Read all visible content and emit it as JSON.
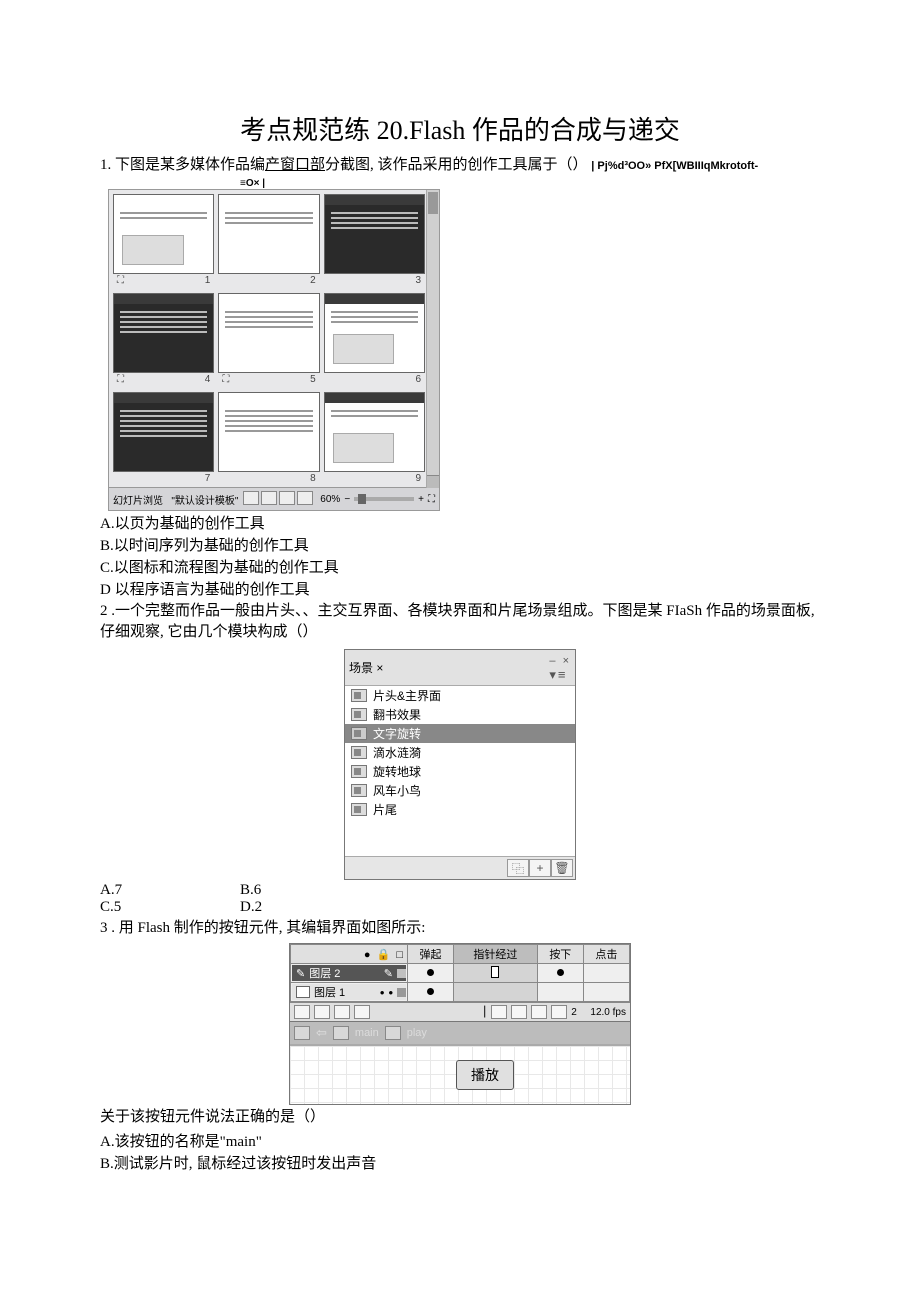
{
  "title": "考点规范练 20.Flash 作品的合成与递交",
  "q1": {
    "num": "1.",
    "stem_a": "下图是某多媒体作品编",
    "stem_u": "产窗口部",
    "stem_b": "分截图, 该作品采用的创作工具属于（）",
    "garble": "| Pj%d³OO» PfX[WBIIIqMkrotoft-",
    "tiny": "≡O× |"
  },
  "fig1": {
    "slide_nums": [
      "1",
      "2",
      "3",
      "4",
      "5",
      "6",
      "7",
      "8",
      "9"
    ],
    "status_left_a": "幻灯片浏览",
    "status_left_b": "\"默认设计模板\"",
    "status_zoom": "60%",
    "status_minus": "−",
    "status_plus": "+"
  },
  "q1_opts": {
    "A": "A.以页为基础的创作工具",
    "B": "B.以时间序列为基础的创作工具",
    "C": "C.以图标和流程图为基础的创作工具",
    "D": "D 以程序语言为基础的创作工具"
  },
  "q2": {
    "num": "2",
    "stem": " .一个完整而作品一般由片头、、主交互界面、各模块界面和片尾场景组成。下图是某 FIaSh 作品的场景面板, 仔细观察, 它由几个模块构成（）"
  },
  "fig2": {
    "title": "场景 ×",
    "title_right": "– ×",
    "menu_dots": "▾≡",
    "items": [
      "片头&主界面",
      "翻书效果",
      "文字旋转",
      "滴水涟漪",
      "旋转地球",
      "风车小鸟",
      "片尾"
    ],
    "selected_index": 2,
    "foot_icons": [
      "⿻",
      "+",
      "🗑"
    ]
  },
  "q2_opts": {
    "A": "A.7",
    "B": "B.6",
    "C": "C.5",
    "D": "D.2"
  },
  "q3": {
    "num": "3",
    "stem": " . 用 Flash 制作的按钮元件, 其编辑界面如图所示:"
  },
  "fig3": {
    "head_icons": [
      "●",
      "🔒",
      "□"
    ],
    "states": [
      "弹起",
      "指针经过",
      "按下",
      "点击"
    ],
    "layers": [
      "图层 2",
      "图层 1"
    ],
    "tools_right_num": "2",
    "tools_fps": "12.0 fps",
    "bread_main": "main",
    "bread_play": "play",
    "stage_button": "播放"
  },
  "q3_tail": {
    "line": "关于该按钮元件说法正确的是（）",
    "A": "A.该按钮的名称是\"main\"",
    "B": "B.测试影片时, 鼠标经过该按钮时发出声音"
  }
}
